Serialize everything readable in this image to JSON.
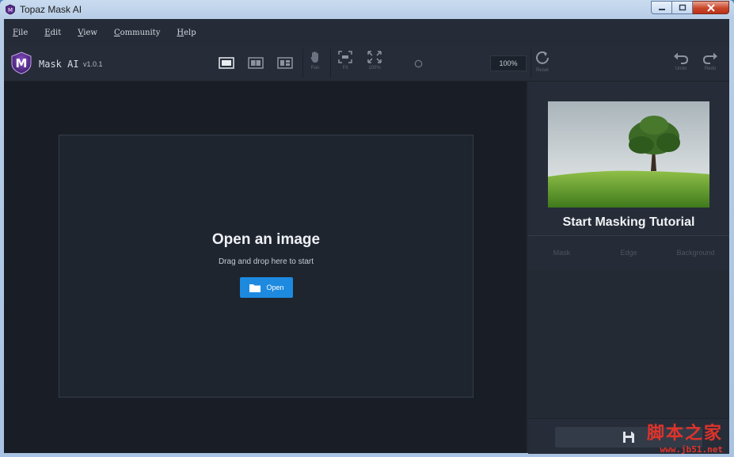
{
  "window": {
    "title": "Topaz Mask AI"
  },
  "menu": {
    "items": [
      "File",
      "Edit",
      "View",
      "Community",
      "Help"
    ]
  },
  "toolbar": {
    "app_name": "Mask AI",
    "version": "v1.0.1",
    "pan_label": "Pan",
    "fit_label": "Fit",
    "zoom100_label": "100%",
    "zoom_value": "100%",
    "reset_label": "Reset",
    "undo_label": "Undo",
    "redo_label": "Redo"
  },
  "canvas": {
    "title": "Open an image",
    "subtitle": "Drag and drop here to start",
    "open_label": "Open"
  },
  "panel": {
    "tutorial_title": "Start Masking Tutorial",
    "tabs": [
      "Mask",
      "Edge",
      "Background"
    ]
  },
  "watermark": {
    "text": "脚本之家",
    "url": "www.jb51.net"
  },
  "colors": {
    "accent": "#1d8ae0",
    "background": "#222831",
    "panel": "#262d38"
  }
}
